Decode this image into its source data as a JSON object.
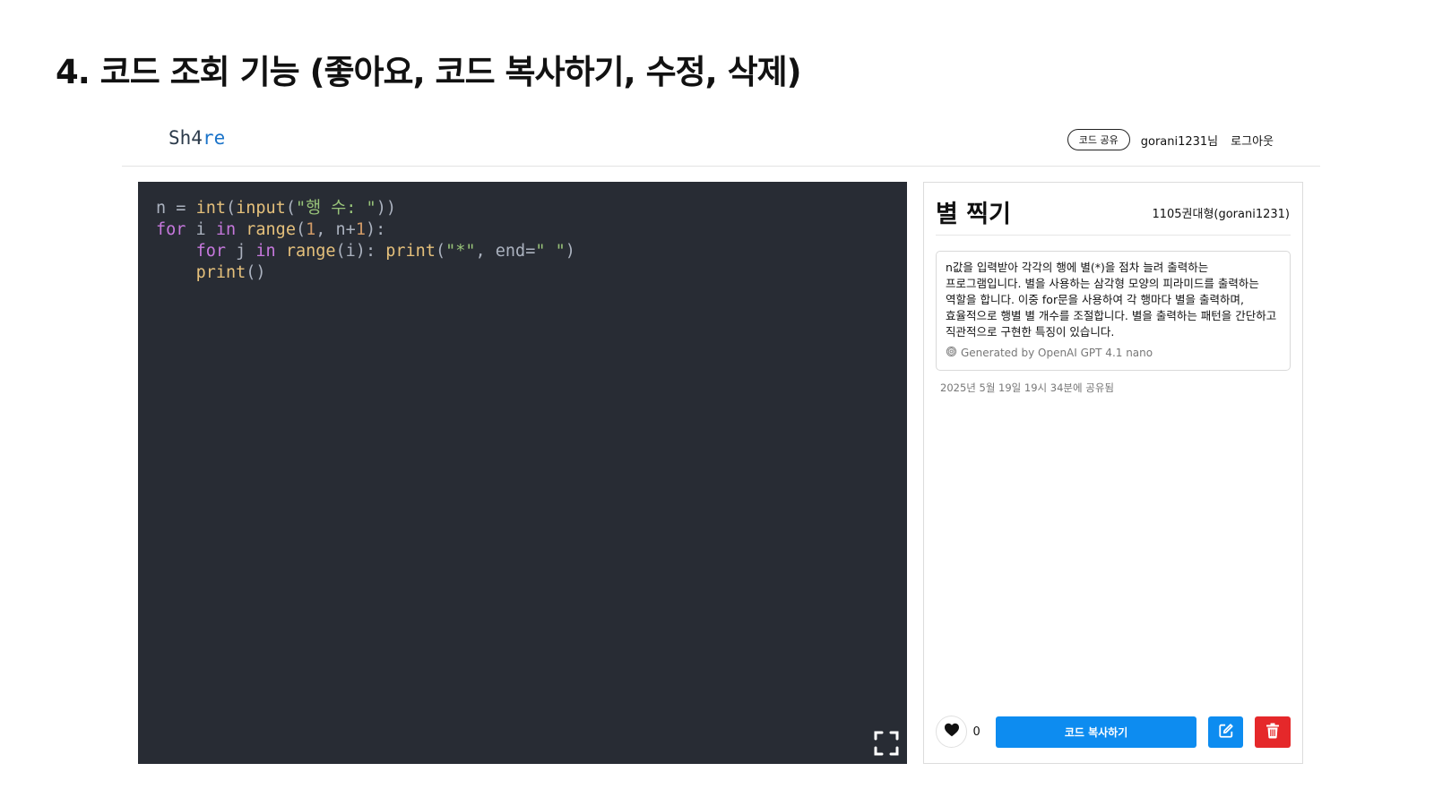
{
  "slide": {
    "title": "4. 코드 조회 기능 (좋아요, 코드 복사하기, 수정, 삭제)"
  },
  "navbar": {
    "logo_part1": "Sh4",
    "logo_part2": "re",
    "share_button": "코드 공유",
    "user": "gorani1231님",
    "logout": "로그아웃"
  },
  "editor": {
    "code_lines": [
      "n = int(input(\"행 수: \"))",
      "for i in range(1, n+1):",
      "    for j in range(i): print(\"*\", end=\" \")",
      "    print()"
    ]
  },
  "post": {
    "title": "별 찍기",
    "author": "1105권대형(gorani1231)",
    "description": "n값을 입력받아 각각의 행에 별(*)을 점차 늘려 출력하는 프로그램입니다. 별을 사용하는 삼각형 모양의 피라미드를 출력하는 역할을 합니다. 이중 for문을 사용하여 각 행마다 별을 출력하며, 효율적으로 행별 별 개수를 조절합니다. 별을 출력하는 패턴을 간단하고 직관적으로 구현한 특징이 있습니다.",
    "generated_by": "Generated by OpenAI GPT 4.1 nano",
    "shared_time": "2025년 5월 19일 19시 34분에 공유됨",
    "like_count": "0",
    "copy_button": "코드 복사하기"
  },
  "colors": {
    "editor_bg": "#282c34",
    "primary_button": "#0d8cf0",
    "danger_button": "#e5282a",
    "logo_accent": "#1a73c9"
  },
  "icons": [
    "openai-icon",
    "heart-icon",
    "edit-icon",
    "trash-icon",
    "fullscreen-icon"
  ]
}
